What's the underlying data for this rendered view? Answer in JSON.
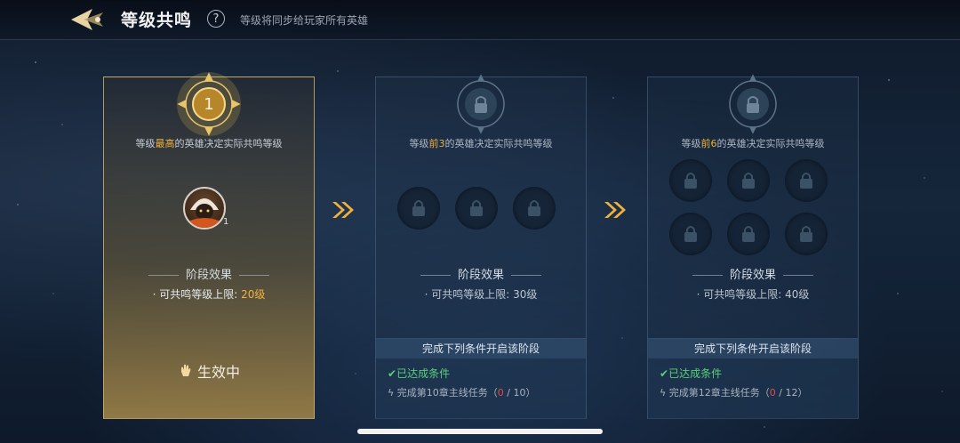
{
  "header": {
    "title": "等级共鸣",
    "help_glyph": "?",
    "subtitle": "等级将同步给玩家所有英雄"
  },
  "stages": [
    {
      "state": "active",
      "medal_number": "1",
      "desc_prefix": "等级",
      "desc_highlight": "最高",
      "desc_suffix": "的英雄决定实际共鸣等级",
      "hero_level": "1",
      "effect_title": "阶段效果",
      "effect_label": "· 可共鸣等级上限: ",
      "effect_value": "20级",
      "status": "生效中"
    },
    {
      "state": "locked",
      "desc_prefix": "等级",
      "desc_highlight": "前3",
      "desc_suffix": "的英雄决定实际共鸣等级",
      "effect_title": "阶段效果",
      "effect_label": "· 可共鸣等级上限: ",
      "effect_value": "30级",
      "cond_title": "完成下列条件开启该阶段",
      "cond_done": "已达成条件",
      "task_text": "完成第10章主线任务（",
      "task_progress": "0",
      "task_total": " / 10）"
    },
    {
      "state": "locked",
      "desc_prefix": "等级",
      "desc_highlight": "前6",
      "desc_suffix": "的英雄决定实际共鸣等级",
      "effect_title": "阶段效果",
      "effect_label": "· 可共鸣等级上限: ",
      "effect_value": "40级",
      "cond_title": "完成下列条件开启该阶段",
      "cond_done": "已达成条件",
      "task_text": "完成第12章主线任务（",
      "task_progress": "0",
      "task_total": " / 12）"
    }
  ],
  "colors": {
    "highlight": "#f0b23c",
    "done": "#59d07a",
    "progress_red": "#e14b4b"
  },
  "icons": [
    "back-arrow-icon",
    "help-icon",
    "medal-icon",
    "lock-icon",
    "double-chevron-right-icon",
    "hand-icon",
    "check-icon",
    "lightning-icon"
  ]
}
